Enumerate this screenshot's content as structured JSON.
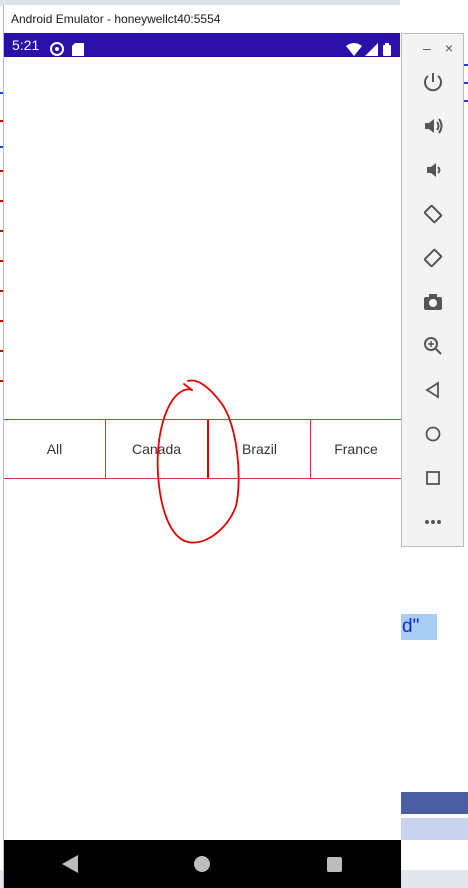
{
  "background_ide": {
    "code_fragment": "d\""
  },
  "emulator": {
    "window_title": "Android Emulator - honeywellct40:5554",
    "status_bar": {
      "time": "5:21"
    },
    "tabs": [
      {
        "label": "All"
      },
      {
        "label": "Canada"
      },
      {
        "label": "Brazil"
      },
      {
        "label": "France"
      }
    ],
    "nav": [
      "back",
      "home",
      "recents"
    ]
  },
  "toolbar": {
    "window_controls": {
      "minimize": "–",
      "close": "×"
    },
    "buttons": [
      "power-icon",
      "volume-up-icon",
      "volume-down-icon",
      "rotate-left-icon",
      "rotate-right-icon",
      "camera-icon",
      "zoom-icon",
      "back-icon",
      "home-icon",
      "overview-icon",
      "more-icon"
    ]
  },
  "colors": {
    "status_bar": "#2a0fa8",
    "tab_border": "#e53030",
    "annotation": "#e00000"
  }
}
